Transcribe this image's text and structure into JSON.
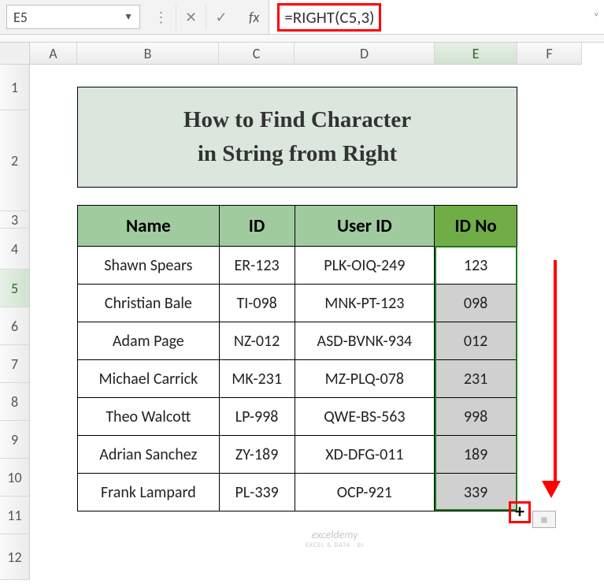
{
  "formula_bar": {
    "cell_ref": "E5",
    "fx_label": "fx",
    "formula_text": "=RIGHT(C5,3)"
  },
  "columns": [
    "A",
    "B",
    "C",
    "D",
    "E",
    "F"
  ],
  "rows": [
    "1",
    "2",
    "3",
    "4",
    "5",
    "6",
    "7",
    "8",
    "9",
    "10",
    "11",
    "12"
  ],
  "selected_column": "E",
  "selected_row": "5",
  "title": {
    "line1": "How to Find Character",
    "line2": "in String from Right"
  },
  "table": {
    "headers": {
      "name": "Name",
      "id": "ID",
      "user_id": "User ID",
      "id_no": "ID No"
    },
    "rows": [
      {
        "name": "Shawn Spears",
        "id": "ER-123",
        "user_id": "PLK-OIQ-249",
        "id_no": "123",
        "filled": false
      },
      {
        "name": "Christian Bale",
        "id": "TI-098",
        "user_id": "MNK-PT-123",
        "id_no": "098",
        "filled": true
      },
      {
        "name": "Adam Page",
        "id": "NZ-012",
        "user_id": "ASD-BVNK-934",
        "id_no": "012",
        "filled": true
      },
      {
        "name": "Michael Carrick",
        "id": "MK-231",
        "user_id": "MZ-PLQ-078",
        "id_no": "231",
        "filled": true
      },
      {
        "name": "Theo Walcott",
        "id": "LP-998",
        "user_id": "QWE-BS-563",
        "id_no": "998",
        "filled": true
      },
      {
        "name": "Adrian Sanchez",
        "id": "ZY-189",
        "user_id": "XD-DFG-011",
        "id_no": "189",
        "filled": true
      },
      {
        "name": "Frank Lampard",
        "id": "PL-339",
        "user_id": "OCP-921",
        "id_no": "339",
        "filled": true
      }
    ]
  },
  "watermark": {
    "main": "exceldemy",
    "sub": "EXCEL & DATA · BI"
  },
  "icons": {
    "dropdown": "▼",
    "cancel": "✕",
    "confirm": "✓",
    "expand": "˅",
    "fill_cross": "+",
    "autofill": "⊞"
  }
}
